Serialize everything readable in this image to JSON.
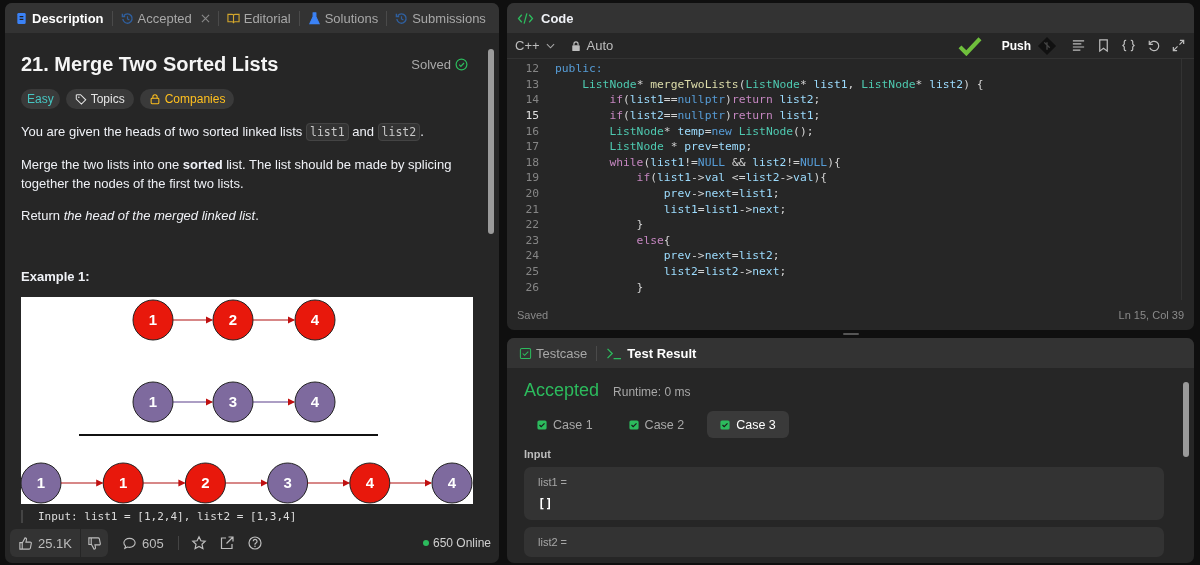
{
  "left_panel": {
    "tabs": [
      {
        "label": "Description",
        "kind": "description",
        "selected": true,
        "closable": false
      },
      {
        "label": "Accepted",
        "kind": "history",
        "selected": false,
        "closable": true
      },
      {
        "label": "Editorial",
        "kind": "editorial",
        "selected": false,
        "closable": false
      },
      {
        "label": "Solutions",
        "kind": "solutions",
        "selected": false,
        "closable": false
      },
      {
        "label": "Submissions",
        "kind": "history",
        "selected": false,
        "closable": false
      }
    ],
    "problem": {
      "title": "21. Merge Two Sorted Lists",
      "status": "Solved",
      "difficulty": "Easy",
      "tags": [
        {
          "label": "Topics",
          "kind": "topics"
        },
        {
          "label": "Companies",
          "kind": "companies"
        }
      ],
      "paragraphs": [
        [
          {
            "kind": "text",
            "text": "You are given the heads of two sorted linked lists "
          },
          {
            "kind": "code",
            "text": "list1"
          },
          {
            "kind": "text",
            "text": " and "
          },
          {
            "kind": "code",
            "text": "list2"
          },
          {
            "kind": "text",
            "text": "."
          }
        ],
        [
          {
            "kind": "text",
            "text": "Merge the two lists into one **sorted** list. The list should be made by splicing together the nodes of the first two lists."
          }
        ],
        [
          {
            "kind": "text",
            "text": "Return *the head of the merged linked list*."
          }
        ]
      ],
      "example_title": "Example 1:",
      "diagram": {
        "rows": [
          [
            {
              "label": "1",
              "color": "#e8180c"
            },
            {
              "label": "2",
              "color": "#e8180c"
            },
            {
              "label": "4",
              "color": "#e8180c"
            }
          ],
          [
            {
              "label": "1",
              "color": "#7e6a9e"
            },
            {
              "label": "3",
              "color": "#7e6a9e"
            },
            {
              "label": "4",
              "color": "#7e6a9e"
            }
          ],
          [
            {
              "label": "1",
              "color": "#7e6a9e"
            },
            {
              "label": "1",
              "color": "#e8180c"
            },
            {
              "label": "2",
              "color": "#e8180c"
            },
            {
              "label": "3",
              "color": "#7e6a9e"
            },
            {
              "label": "4",
              "color": "#e8180c"
            },
            {
              "label": "4",
              "color": "#7e6a9e"
            }
          ]
        ]
      },
      "input_line": "Input: list1 = [1,2,4], list2 = [1,3,4]"
    },
    "footer": {
      "likes": "25.1K",
      "comments": "605",
      "online": "650 Online"
    }
  },
  "code_panel": {
    "title": "Code",
    "language": "C++",
    "mode": "Auto",
    "push_label": "Push",
    "status": "Saved",
    "cursor": "Ln 15, Col 39",
    "lines": [
      {
        "number": "12",
        "current": false,
        "tokens": [
          {
            "kind": "kw",
            "text": "public:"
          }
        ]
      },
      {
        "number": "13",
        "current": false,
        "tokens": [
          {
            "kind": "type",
            "text": "    ListNode"
          },
          {
            "kind": "plain",
            "text": "* "
          },
          {
            "kind": "fn",
            "text": "mergeTwoLists"
          },
          {
            "kind": "plain",
            "text": "("
          },
          {
            "kind": "type",
            "text": "ListNode"
          },
          {
            "kind": "plain",
            "text": "* "
          },
          {
            "kind": "var",
            "text": "list1"
          },
          {
            "kind": "plain",
            "text": ", "
          },
          {
            "kind": "type",
            "text": "ListNode"
          },
          {
            "kind": "plain",
            "text": "* "
          },
          {
            "kind": "var",
            "text": "list2"
          },
          {
            "kind": "plain",
            "text": ") {"
          }
        ]
      },
      {
        "number": "14",
        "current": false,
        "tokens": [
          {
            "kind": "ctrl",
            "text": "        if"
          },
          {
            "kind": "plain",
            "text": "("
          },
          {
            "kind": "var",
            "text": "list1"
          },
          {
            "kind": "plain",
            "text": "=="
          },
          {
            "kind": "kw",
            "text": "nullptr"
          },
          {
            "kind": "plain",
            "text": ")"
          },
          {
            "kind": "ctrl",
            "text": "return"
          },
          {
            "kind": "var",
            "text": " list2"
          },
          {
            "kind": "plain",
            "text": ";"
          }
        ]
      },
      {
        "number": "15",
        "current": true,
        "tokens": [
          {
            "kind": "ctrl",
            "text": "        if"
          },
          {
            "kind": "plain",
            "text": "("
          },
          {
            "kind": "var",
            "text": "list2"
          },
          {
            "kind": "plain",
            "text": "=="
          },
          {
            "kind": "kw",
            "text": "nullptr"
          },
          {
            "kind": "plain",
            "text": ")"
          },
          {
            "kind": "ctrl",
            "text": "return"
          },
          {
            "kind": "var",
            "text": " list1"
          },
          {
            "kind": "plain",
            "text": ";"
          }
        ]
      },
      {
        "number": "16",
        "current": false,
        "tokens": [
          {
            "kind": "type",
            "text": "        ListNode"
          },
          {
            "kind": "plain",
            "text": "* "
          },
          {
            "kind": "var",
            "text": "temp"
          },
          {
            "kind": "plain",
            "text": "="
          },
          {
            "kind": "kw",
            "text": "new"
          },
          {
            "kind": "type",
            "text": " ListNode"
          },
          {
            "kind": "plain",
            "text": "();"
          }
        ]
      },
      {
        "number": "17",
        "current": false,
        "tokens": [
          {
            "kind": "type",
            "text": "        ListNode"
          },
          {
            "kind": "plain",
            "text": " * "
          },
          {
            "kind": "var",
            "text": "prev"
          },
          {
            "kind": "plain",
            "text": "="
          },
          {
            "kind": "var",
            "text": "temp"
          },
          {
            "kind": "plain",
            "text": ";"
          }
        ]
      },
      {
        "number": "18",
        "current": false,
        "tokens": [
          {
            "kind": "ctrl",
            "text": "        while"
          },
          {
            "kind": "plain",
            "text": "("
          },
          {
            "kind": "var",
            "text": "list1"
          },
          {
            "kind": "plain",
            "text": "!="
          },
          {
            "kind": "kw",
            "text": "NULL"
          },
          {
            "kind": "plain",
            "text": " && "
          },
          {
            "kind": "var",
            "text": "list2"
          },
          {
            "kind": "plain",
            "text": "!="
          },
          {
            "kind": "kw",
            "text": "NULL"
          },
          {
            "kind": "plain",
            "text": "){"
          }
        ]
      },
      {
        "number": "19",
        "current": false,
        "tokens": [
          {
            "kind": "ctrl",
            "text": "            if"
          },
          {
            "kind": "plain",
            "text": "("
          },
          {
            "kind": "var",
            "text": "list1"
          },
          {
            "kind": "plain",
            "text": "->"
          },
          {
            "kind": "var",
            "text": "val"
          },
          {
            "kind": "plain",
            "text": " <="
          },
          {
            "kind": "var",
            "text": "list2"
          },
          {
            "kind": "plain",
            "text": "->"
          },
          {
            "kind": "var",
            "text": "val"
          },
          {
            "kind": "plain",
            "text": "){"
          }
        ]
      },
      {
        "number": "20",
        "current": false,
        "tokens": [
          {
            "kind": "var",
            "text": "                prev"
          },
          {
            "kind": "plain",
            "text": "->"
          },
          {
            "kind": "var",
            "text": "next"
          },
          {
            "kind": "plain",
            "text": "="
          },
          {
            "kind": "var",
            "text": "list1"
          },
          {
            "kind": "plain",
            "text": ";"
          }
        ]
      },
      {
        "number": "21",
        "current": false,
        "tokens": [
          {
            "kind": "var",
            "text": "                list1"
          },
          {
            "kind": "plain",
            "text": "="
          },
          {
            "kind": "var",
            "text": "list1"
          },
          {
            "kind": "plain",
            "text": "->"
          },
          {
            "kind": "var",
            "text": "next"
          },
          {
            "kind": "plain",
            "text": ";"
          }
        ]
      },
      {
        "number": "22",
        "current": false,
        "tokens": [
          {
            "kind": "plain",
            "text": "            }"
          }
        ]
      },
      {
        "number": "23",
        "current": false,
        "tokens": [
          {
            "kind": "ctrl",
            "text": "            else"
          },
          {
            "kind": "plain",
            "text": "{"
          }
        ]
      },
      {
        "number": "24",
        "current": false,
        "tokens": [
          {
            "kind": "var",
            "text": "                prev"
          },
          {
            "kind": "plain",
            "text": "->"
          },
          {
            "kind": "var",
            "text": "next"
          },
          {
            "kind": "plain",
            "text": "="
          },
          {
            "kind": "var",
            "text": "list2"
          },
          {
            "kind": "plain",
            "text": ";"
          }
        ]
      },
      {
        "number": "25",
        "current": false,
        "tokens": [
          {
            "kind": "var",
            "text": "                list2"
          },
          {
            "kind": "plain",
            "text": "="
          },
          {
            "kind": "var",
            "text": "list2"
          },
          {
            "kind": "plain",
            "text": "->"
          },
          {
            "kind": "var",
            "text": "next"
          },
          {
            "kind": "plain",
            "text": ";"
          }
        ]
      },
      {
        "number": "26",
        "current": false,
        "tokens": [
          {
            "kind": "plain",
            "text": "            }"
          }
        ]
      }
    ]
  },
  "result_panel": {
    "tabs": [
      {
        "label": "Testcase",
        "kind": "testcase",
        "selected": false
      },
      {
        "label": "Test Result",
        "kind": "result",
        "selected": true
      }
    ],
    "verdict": "Accepted",
    "runtime": "Runtime: 0 ms",
    "cases": [
      {
        "label": "Case 1",
        "passed": true,
        "selected": false
      },
      {
        "label": "Case 2",
        "passed": true,
        "selected": false
      },
      {
        "label": "Case 3",
        "passed": true,
        "selected": true
      }
    ],
    "input_title": "Input",
    "inputs": [
      {
        "name": "list1 =",
        "value": "[]"
      },
      {
        "name": "list2 ="
      }
    ]
  }
}
